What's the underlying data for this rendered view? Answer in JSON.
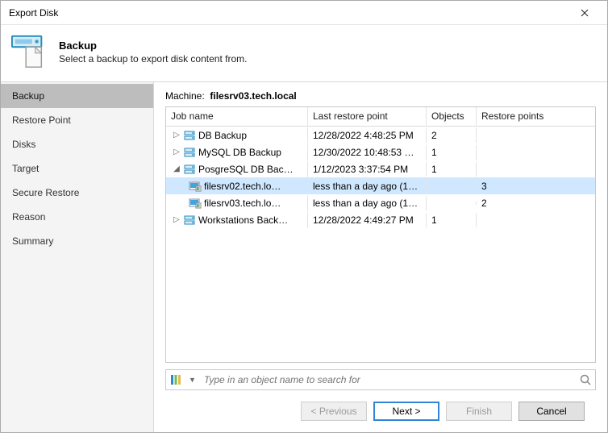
{
  "window": {
    "title": "Export Disk"
  },
  "banner": {
    "heading": "Backup",
    "sub": "Select a backup to export disk content from."
  },
  "sidebar": {
    "items": [
      {
        "label": "Backup",
        "active": true
      },
      {
        "label": "Restore Point",
        "active": false
      },
      {
        "label": "Disks",
        "active": false
      },
      {
        "label": "Target",
        "active": false
      },
      {
        "label": "Secure Restore",
        "active": false
      },
      {
        "label": "Reason",
        "active": false
      },
      {
        "label": "Summary",
        "active": false
      }
    ]
  },
  "machine": {
    "label": "Machine:",
    "value": "filesrv03.tech.local"
  },
  "grid": {
    "columns": {
      "job": "Job name",
      "lrp": "Last restore point",
      "obj": "Objects",
      "rp": "Restore points"
    },
    "rows": [
      {
        "kind": "job",
        "exp": "▷",
        "name": "DB Backup",
        "lrp": "12/28/2022 4:48:25 PM",
        "obj": "2",
        "rp": ""
      },
      {
        "kind": "job",
        "exp": "▷",
        "name": "MySQL DB Backup",
        "lrp": "12/30/2022 10:48:53 …",
        "obj": "1",
        "rp": ""
      },
      {
        "kind": "job",
        "exp": "◢",
        "name": "PosgreSQL DB Bac…",
        "lrp": "1/12/2023 3:37:54 PM",
        "obj": "1",
        "rp": ""
      },
      {
        "kind": "child",
        "sel": true,
        "name": "filesrv02.tech.lo…",
        "lrp": "less than a day ago (1…",
        "obj": "",
        "rp": "3"
      },
      {
        "kind": "child",
        "sel": false,
        "name": "filesrv03.tech.lo…",
        "lrp": "less than a day ago (1…",
        "obj": "",
        "rp": "2"
      },
      {
        "kind": "job",
        "exp": "▷",
        "name": "Workstations Back…",
        "lrp": "12/28/2022 4:49:27 PM",
        "obj": "1",
        "rp": ""
      }
    ]
  },
  "search": {
    "placeholder": "Type in an object name to search for"
  },
  "footer": {
    "prev": "< Previous",
    "next": "Next >",
    "finish": "Finish",
    "cancel": "Cancel"
  }
}
